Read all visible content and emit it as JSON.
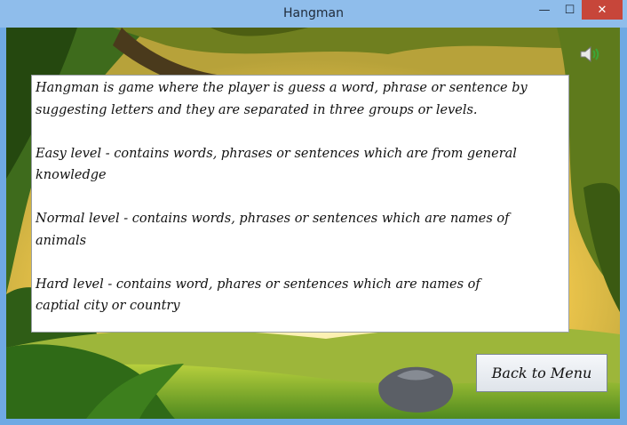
{
  "window": {
    "title": "Hangman",
    "controls": {
      "minimize": "—",
      "maximize": "☐",
      "close": "✕"
    }
  },
  "colors": {
    "sky": "#f6d96a",
    "foliage": "#7c8f1f",
    "ground": "#8fb22c",
    "titlebar": "#8fbdeb",
    "close": "#c7463a"
  },
  "icons": {
    "sound": "speaker-icon"
  },
  "instructions": {
    "p1_line1": "Hangman is game where the player is guess a word, phrase or sentence by",
    "p1_line2": "suggesting letters and they are separated in three groups or levels.",
    "p2_line1": "Easy level - contains words, phrases or sentences which are from general",
    "p2_line2": "knowledge",
    "p3_line1": "Normal level - contains words, phrases or sentences which are names of",
    "p3_line2": "animals",
    "p4_line1": "Hard level - contains word, phares or sentences which are names of",
    "p4_line2": "captial city or country"
  },
  "buttons": {
    "back": "Back to Menu"
  }
}
